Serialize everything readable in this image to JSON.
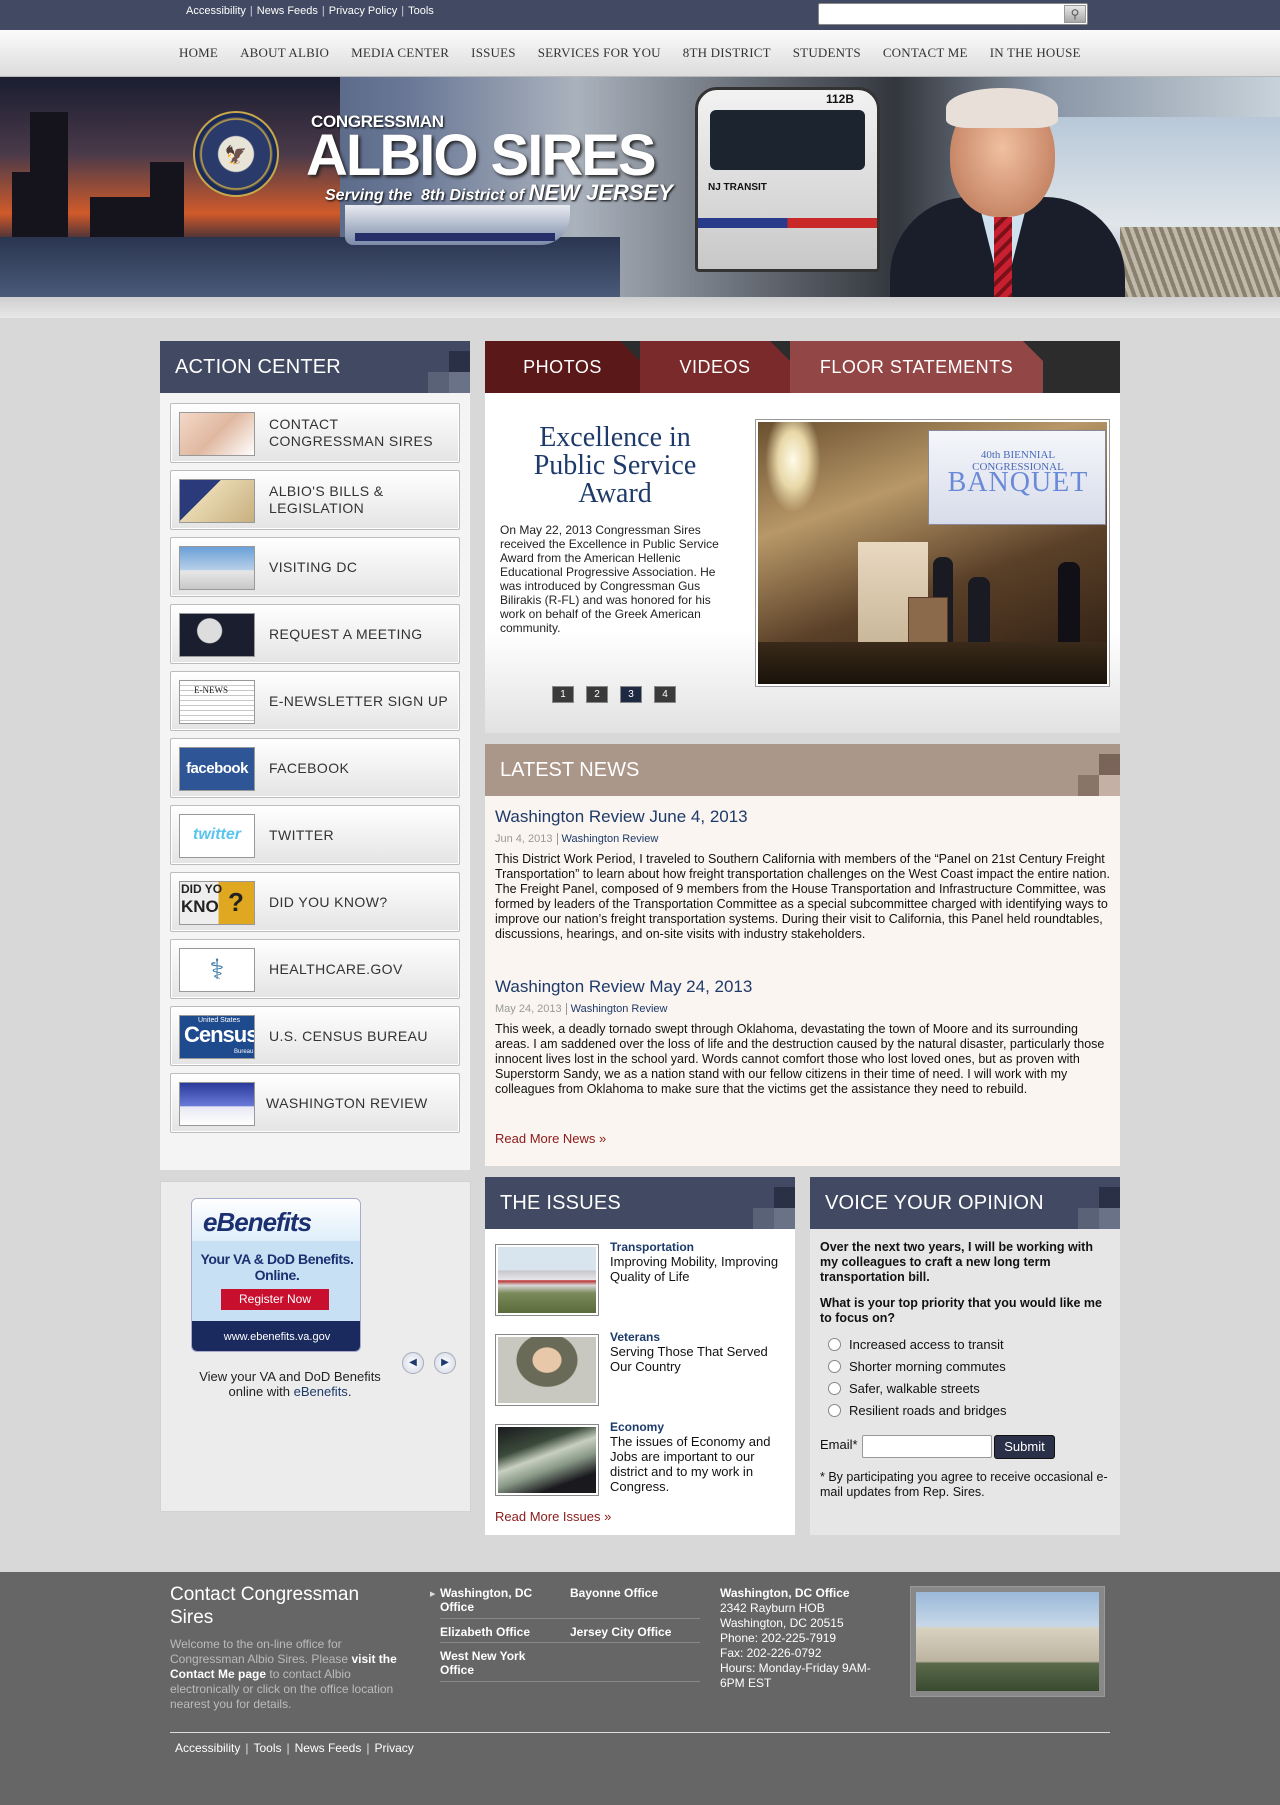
{
  "top_links": [
    "Accessibility",
    "News Feeds",
    "Privacy Policy",
    "Tools"
  ],
  "search": {
    "placeholder": "",
    "button_icon": "search-icon"
  },
  "nav": [
    "HOME",
    "ABOUT ALBIO",
    "MEDIA CENTER",
    "ISSUES",
    "SERVICES FOR YOU",
    "8TH DISTRICT",
    "STUDENTS",
    "CONTACT ME",
    "IN THE HOUSE"
  ],
  "banner": {
    "title_small": "CONGRESSMAN",
    "title_big": "ALBIO SIRES",
    "tagline_a": "Serving the",
    "tagline_b": "8th District of",
    "tagline_c": "NEW JERSEY",
    "train_number": "112B",
    "train_brand": "NJ TRANSIT"
  },
  "action_center": {
    "title": "ACTION CENTER",
    "items": [
      {
        "label": "CONTACT CONGRESSMAN SIRES",
        "thumb": "typing-hands"
      },
      {
        "label": "ALBIO'S BILLS & LEGISLATION",
        "thumb": "constitution-flag"
      },
      {
        "label": "VISITING DC",
        "thumb": "capitol"
      },
      {
        "label": "REQUEST A MEETING",
        "thumb": "meeting"
      },
      {
        "label": "E-NEWSLETTER SIGN UP",
        "thumb": "newsletter"
      },
      {
        "label": "FACEBOOK",
        "thumb": "facebook"
      },
      {
        "label": "TWITTER",
        "thumb": "twitter"
      },
      {
        "label": "DID YOU KNOW?",
        "thumb": "did-you-know"
      },
      {
        "label": "HEALTHCARE.GOV",
        "thumb": "stethoscope"
      },
      {
        "label": "U.S. CENSUS BUREAU",
        "thumb": "census"
      },
      {
        "label": "WASHINGTON REVIEW",
        "thumb": "capitol-dome"
      }
    ],
    "thumb_text": {
      "facebook": "facebook",
      "twitter": "twitter",
      "did_you_know_a": "DID YO",
      "did_you_know_b": "KNO",
      "census_small": "United States",
      "census_big": "Census",
      "census_sub": "Bureau",
      "enews": "E-NEWS"
    }
  },
  "media_tabs": [
    "PHOTOS",
    "VIDEOS",
    "FLOOR STATEMENTS"
  ],
  "slide": {
    "title": "Excellence in Public Service Award",
    "text": "On May 22, 2013 Congressman Sires received the Excellence in Public Service Award from the American Hellenic Educational Progressive Association. He was introduced by Congressman Gus Bilirakis (R-FL) and was honored for his work on behalf of the Greek American community.",
    "screen_text_a": "40th BIENNIAL CONGRESSIONAL",
    "screen_text_b": "BANQUET",
    "pages": [
      "1",
      "2",
      "3",
      "4"
    ],
    "active_page": "3"
  },
  "news": {
    "title": "LATEST NEWS",
    "items": [
      {
        "title": "Washington Review June 4, 2013",
        "date": "Jun 4, 2013",
        "category": "Washington Review",
        "text": "This District Work Period, I traveled to Southern California with members of the “Panel on 21st Century Freight Transportation” to learn about how freight transportation challenges on the West Coast impact the entire nation. The Freight Panel, composed of 9 members from the House Transportation and Infrastructure Committee, was formed by leaders of the Transportation Committee as a special subcommittee charged with identifying ways to improve our nation’s freight transportation systems. During their visit to California, this Panel held roundtables, discussions, hearings, and on-site visits with industry stakeholders."
      },
      {
        "title": "Washington Review May 24, 2013",
        "date": "May 24, 2013",
        "category": "Washington Review",
        "text": "This week, a deadly tornado swept through Oklahoma, devastating the town of Moore and its surrounding areas. I am saddened over the loss of life and the destruction caused by the natural disaster, particularly those innocent lives lost in the school yard. Words cannot comfort those who lost loved ones, but as proven with Superstorm Sandy, we as a nation stand with our fellow citizens in their time of need. I will work with my colleagues from Oklahoma to make sure that the victims get the assistance they need to rebuild."
      }
    ],
    "read_more": "Read More News »"
  },
  "ebenefits": {
    "logo": "eBenefits",
    "tagline": "Your VA & DoD Benefits. Online.",
    "button": "Register Now",
    "url": "www.ebenefits.va.gov",
    "caption_pre": "View your VA and DoD Benefits online with",
    "caption_link": "eBenefits",
    "caption_post": "."
  },
  "issues": {
    "title": "THE ISSUES",
    "items": [
      {
        "title": "Transportation",
        "text": "Improving Mobility, Improving Quality of Life"
      },
      {
        "title": "Veterans",
        "text": "Serving Those That Served Our Country"
      },
      {
        "title": "Economy",
        "text": "The issues of Economy and Jobs are important to our district and to my work in Congress."
      }
    ],
    "read_more": "Read More Issues »"
  },
  "poll": {
    "title": "VOICE YOUR OPINION",
    "intro": "Over the next two years, I will be working with my colleagues to craft a new long term transportation bill.",
    "question": "What is your top priority that you would like me to focus on?",
    "options": [
      "Increased access to transit",
      "Shorter morning commutes",
      "Safer, walkable streets",
      "Resilient roads and bridges"
    ],
    "email_label": "Email*",
    "email_value": "",
    "submit": "Submit",
    "note": "* By participating you agree to receive occasional e-mail updates from Rep. Sires."
  },
  "footer": {
    "title": "Contact Congressman Sires",
    "desc_a": "Welcome to the on-line office for Congressman Albio Sires. Please",
    "desc_link": "visit the Contact Me page",
    "desc_b": "to contact Albio electronically or click on the office location nearest you for details.",
    "offices": [
      "Washington, DC Office",
      "Bayonne Office",
      "Elizabeth Office",
      "Jersey City Office",
      "West New York Office"
    ],
    "address": {
      "title": "Washington, DC Office",
      "line1": "2342 Rayburn HOB",
      "line2": "Washington, DC 20515",
      "phone": "Phone: 202-225-7919",
      "fax": "Fax: 202-226-0792",
      "hours": "Hours: Monday-Friday 9AM-6PM EST"
    },
    "links": [
      "Accessibility",
      "Tools",
      "News Feeds",
      "Privacy"
    ]
  },
  "colors": {
    "navy": "#414a62",
    "news_tan": "#ab968a",
    "link_blue": "#1e3a6a",
    "read_more_red": "#8a1a1a",
    "footer": "#666666"
  }
}
